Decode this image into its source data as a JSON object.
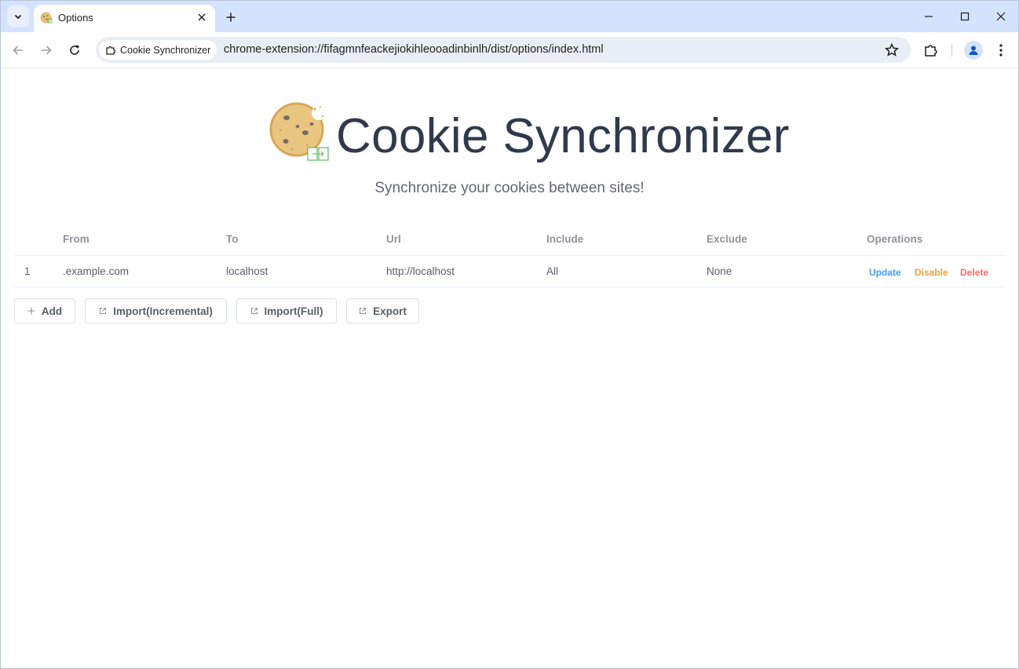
{
  "browser": {
    "tab_title": "Options",
    "site_chip": "Cookie Synchronizer",
    "url": "chrome-extension://fifagmnfeackejiokihleooadinbinlh/dist/options/index.html"
  },
  "page": {
    "title": "Cookie Synchronizer",
    "subtitle": "Synchronize your cookies between sites!"
  },
  "table": {
    "headers": [
      "From",
      "To",
      "Url",
      "Include",
      "Exclude",
      "Operations"
    ],
    "rows": [
      {
        "index": "1",
        "from": ".example.com",
        "to": "localhost",
        "url": "http://localhost",
        "include": "All",
        "exclude": "None",
        "ops": [
          "Update",
          "Disable",
          "Delete"
        ]
      }
    ]
  },
  "actions": {
    "add": "Add",
    "import_incremental": "Import(Incremental)",
    "import_full": "Import(Full)",
    "export": "Export"
  },
  "icons": {
    "add": "plus-icon",
    "import": "external-link-icon",
    "export": "external-link-icon"
  },
  "colors": {
    "update": "#409eff",
    "disable": "#e6a23c",
    "delete": "#f56c6c",
    "title": "#2f3a4c",
    "chrome_titlebar": "#d3e3fd"
  }
}
